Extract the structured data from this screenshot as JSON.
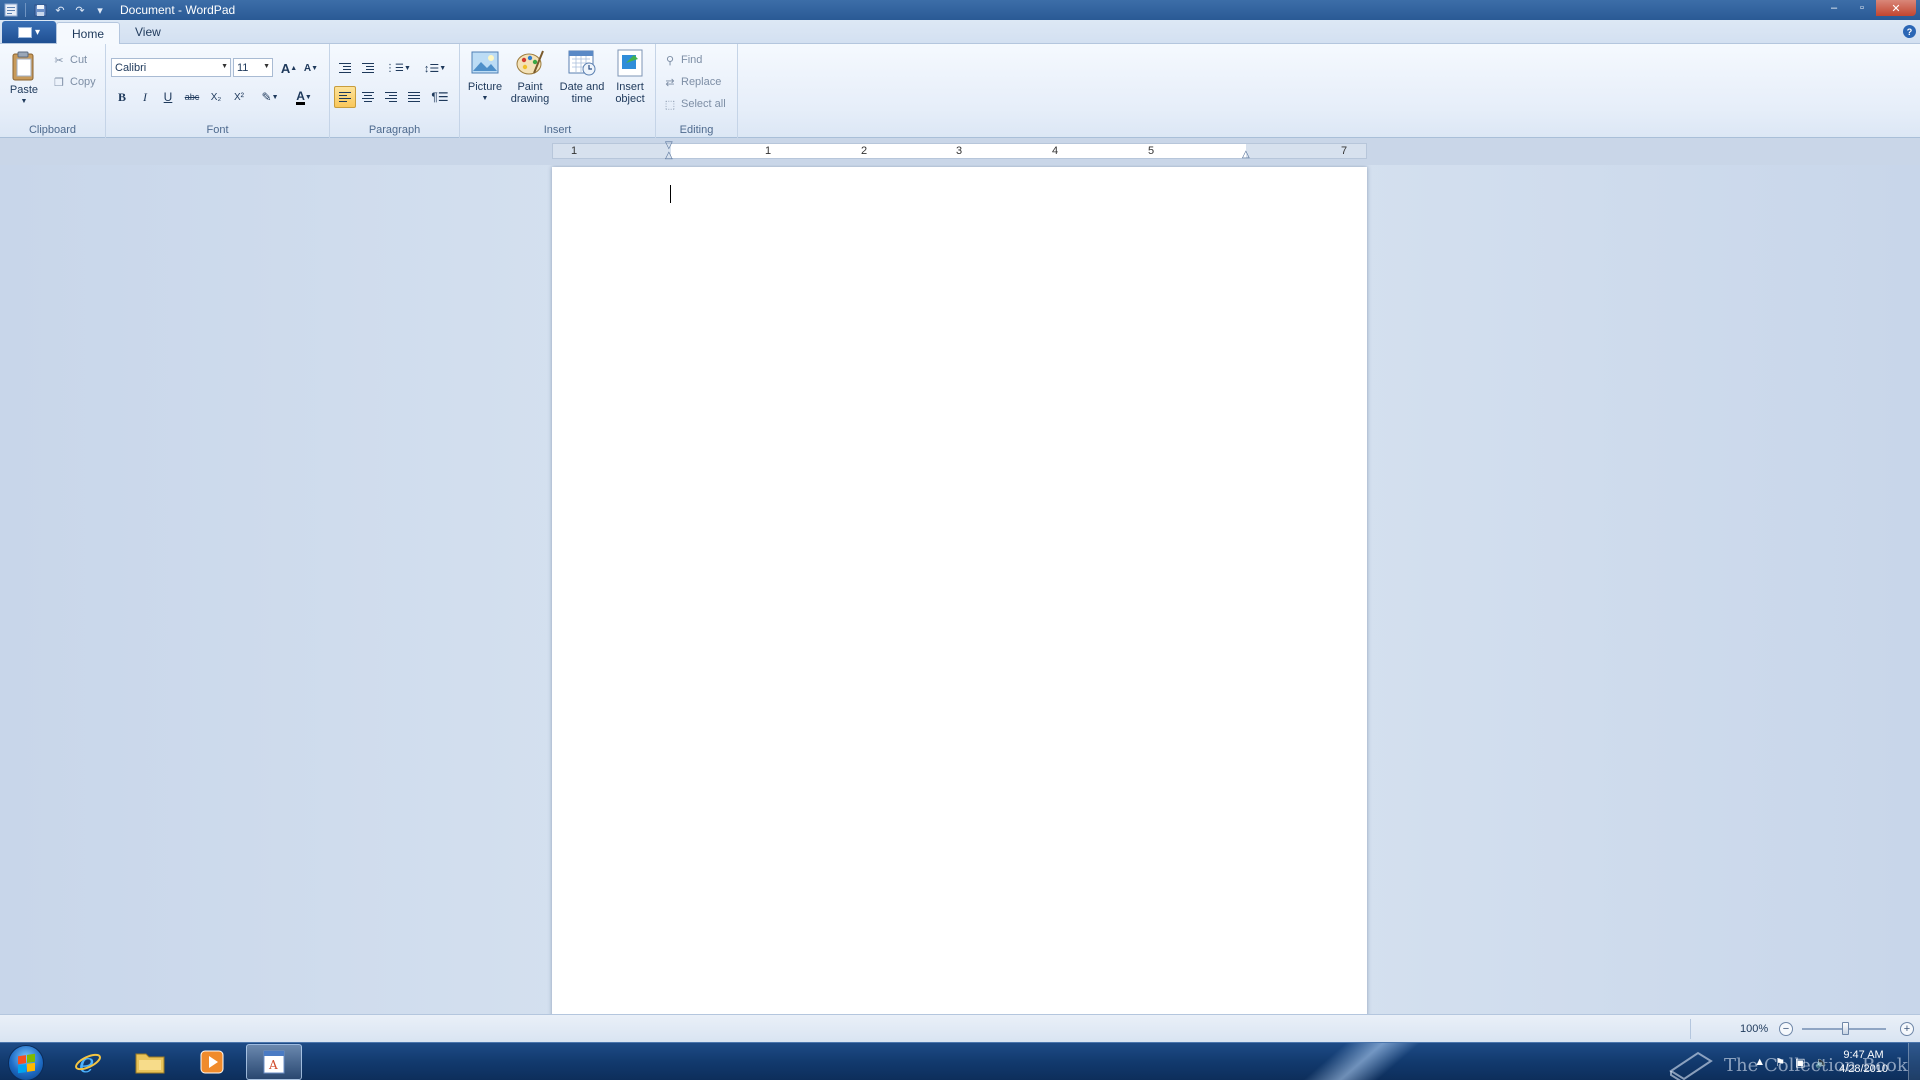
{
  "window": {
    "title": "Document - WordPad",
    "minimize": "–",
    "maximize": "▫",
    "close": "✕"
  },
  "tabs": [
    {
      "label": "Home",
      "active": true
    },
    {
      "label": "View",
      "active": false
    }
  ],
  "ribbon": {
    "clipboard": {
      "label": "Clipboard",
      "paste": "Paste",
      "cut": "Cut",
      "copy": "Copy"
    },
    "font": {
      "label": "Font",
      "family": "Calibri",
      "size": "11",
      "bold": "B",
      "italic": "I",
      "underline": "U",
      "strike": "abc",
      "subscript": "X₂",
      "superscript": "X²",
      "grow": "A",
      "shrink": "A"
    },
    "paragraph": {
      "label": "Paragraph"
    },
    "insert": {
      "label": "Insert",
      "picture": "Picture",
      "paint": "Paint drawing",
      "datetime": "Date and time",
      "object": "Insert object"
    },
    "editing": {
      "label": "Editing",
      "find": "Find",
      "replace": "Replace",
      "select_all": "Select all"
    }
  },
  "ruler": {
    "numbers": [
      "1",
      "1",
      "2",
      "3",
      "4",
      "5",
      "7"
    ]
  },
  "status": {
    "zoom": "100%",
    "zoom_out": "−",
    "zoom_in": "+",
    "zoom_level": 0.5
  },
  "taskbar": {
    "watermark": "The Collection Book",
    "time": "9:47 AM",
    "date": "4/28/2010"
  },
  "colors": {
    "accent": "#2a5a95",
    "ribbon": "#e6eef9",
    "workspace": "#d4e0ef"
  }
}
